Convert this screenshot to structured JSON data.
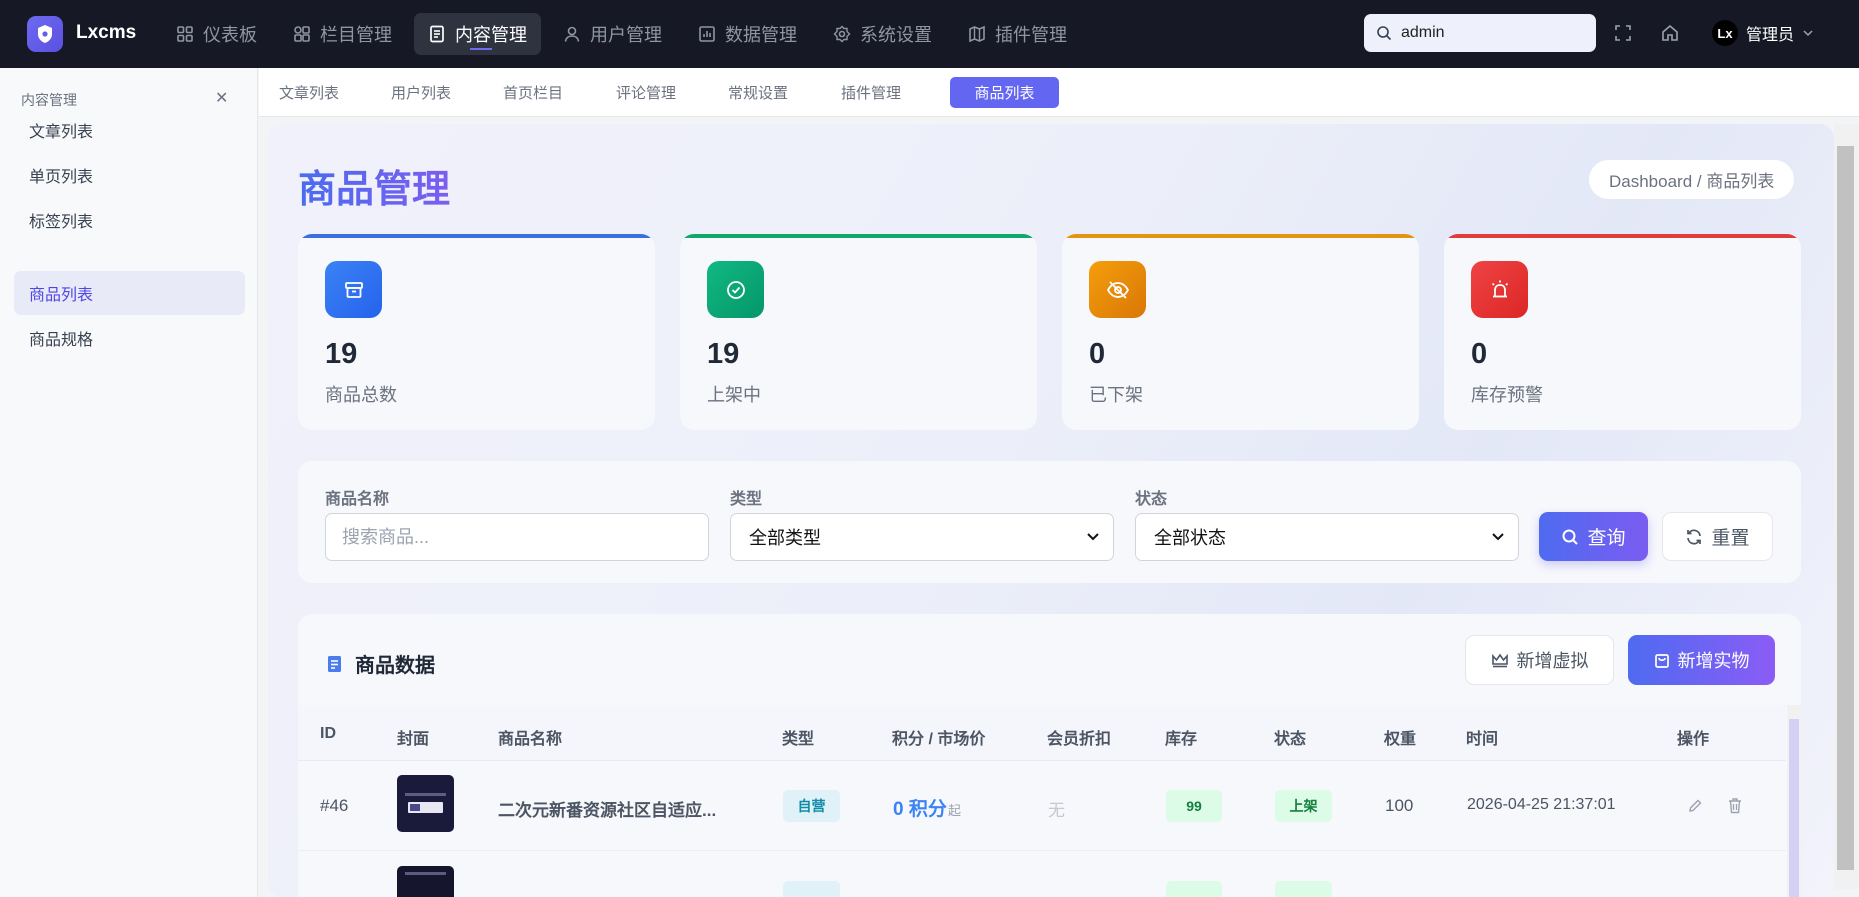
{
  "app": {
    "name": "Lxcms"
  },
  "nav": [
    {
      "label": "仪表板",
      "icon": "dashboard-icon"
    },
    {
      "label": "栏目管理",
      "icon": "grid-icon"
    },
    {
      "label": "内容管理",
      "icon": "document-icon",
      "active": true
    },
    {
      "label": "用户管理",
      "icon": "user-icon"
    },
    {
      "label": "数据管理",
      "icon": "chart-icon"
    },
    {
      "label": "系统设置",
      "icon": "gear-icon"
    },
    {
      "label": "插件管理",
      "icon": "map-icon"
    }
  ],
  "search": {
    "value": "admin"
  },
  "user": {
    "avatar_text": "Lx",
    "name": "管理员"
  },
  "sidebar": {
    "title": "内容管理",
    "items": [
      {
        "label": "文章列表"
      },
      {
        "label": "单页列表"
      },
      {
        "label": "标签列表"
      },
      {
        "label": "商品列表",
        "active": true
      },
      {
        "label": "商品规格"
      }
    ]
  },
  "tabs": [
    {
      "label": "文章列表"
    },
    {
      "label": "用户列表"
    },
    {
      "label": "首页栏目"
    },
    {
      "label": "评论管理"
    },
    {
      "label": "常规设置"
    },
    {
      "label": "插件管理"
    },
    {
      "label": "商品列表",
      "active": true
    }
  ],
  "page": {
    "title": "商品管理",
    "breadcrumb": "Dashboard / 商品列表"
  },
  "stats": [
    {
      "value": "19",
      "label": "商品总数",
      "color": "#3b82f6",
      "icon": "box-icon"
    },
    {
      "value": "19",
      "label": "上架中",
      "color": "#10b981",
      "icon": "check-circle-icon"
    },
    {
      "value": "0",
      "label": "已下架",
      "color": "#f59e0b",
      "icon": "eye-off-icon"
    },
    {
      "value": "0",
      "label": "库存预警",
      "color": "#ef4444",
      "icon": "alarm-icon"
    }
  ],
  "filter": {
    "name_label": "商品名称",
    "name_placeholder": "搜索商品...",
    "type_label": "类型",
    "type_value": "全部类型",
    "status_label": "状态",
    "status_value": "全部状态",
    "query_label": "查询",
    "reset_label": "重置"
  },
  "table": {
    "title": "商品数据",
    "add_virtual_label": "新增虚拟",
    "add_real_label": "新增实物",
    "columns": [
      "ID",
      "封面",
      "商品名称",
      "类型",
      "积分 / 市场价",
      "会员折扣",
      "库存",
      "状态",
      "权重",
      "时间",
      "操作"
    ],
    "rows": [
      {
        "id": "#46",
        "name": "二次元新番资源社区自适应...",
        "type": "自营",
        "points": "0 积分",
        "points_suffix": "起",
        "discount": "无",
        "stock": "99",
        "status": "上架",
        "weight": "100",
        "time": "2026-04-25 21:37:01"
      }
    ]
  }
}
